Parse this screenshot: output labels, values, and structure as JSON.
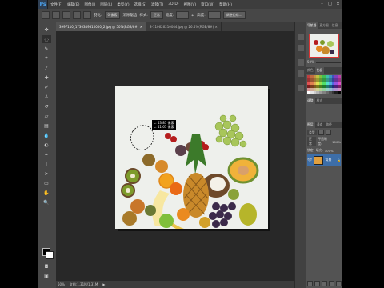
{
  "menubar": {
    "logo": "Ps",
    "items": [
      "文件(F)",
      "编辑(E)",
      "图像(I)",
      "图层(L)",
      "类型(Y)",
      "选择(S)",
      "滤镜(T)",
      "3D(D)",
      "视图(V)",
      "窗口(W)",
      "帮助(H)"
    ]
  },
  "options": {
    "feather_label": "羽化:",
    "feather_value": "0 像素",
    "antialias": "消除锯齿",
    "style_label": "样式:",
    "style_value": "正常",
    "width_label": "宽度:",
    "height_label": "高度:",
    "refine_edge": "调整边缘..."
  },
  "tabs": [
    "3997110_1730349810000_2.jpg @ 50%(RGB/8#) ×",
    "8-110626210044.jpg @ 26.5%(RGB/8#) ×"
  ],
  "tooltip": {
    "line1": "L: 53.87 像素",
    "line2": "L: 41.67 像素"
  },
  "status": {
    "zoom": "50%",
    "doc": "文档:1.31M/1.31M"
  },
  "panels": {
    "nav_tabs": [
      "导航器",
      "直方图",
      "信息",
      "Ruler"
    ],
    "nav_zoom": "50%",
    "color_tabs": [
      "颜色",
      "色板"
    ],
    "adjust_tabs": [
      "调整",
      "样式"
    ],
    "layers_tabs": [
      "图层",
      "通道",
      "路径"
    ],
    "kind_label": "类型",
    "blend_mode": "正常",
    "opacity_label": "不透明度:",
    "opacity_value": "100%",
    "lock_label": "锁定:",
    "fill_label": "填充:",
    "fill_value": "100%",
    "layer_name": "背景"
  }
}
